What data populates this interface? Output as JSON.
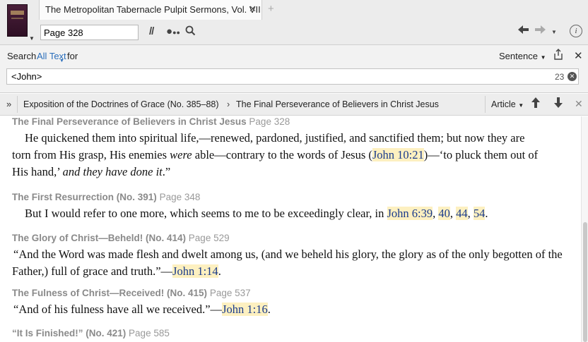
{
  "tab": {
    "title": "The Metropolitan Tabernacle Pulpit Sermons, Vol. VII",
    "close_glyph": "✕",
    "add_glyph": "+"
  },
  "toolbar": {
    "page_value": "Page 328",
    "icons": [
      "book-cover-icon",
      "parallel-resources-icon",
      "visual-filter-icon",
      "search-icon",
      "back-arrow-icon",
      "forward-arrow-icon",
      "info-icon"
    ]
  },
  "search": {
    "label": "Search",
    "scope": "All Text",
    "for_label": "for",
    "mode": "Sentence",
    "query": "<John>",
    "result_count": "23"
  },
  "breadcrumb": {
    "items": [
      "Exposition of the Doctrines of Grace (No. 385–88)",
      "The Final Perseverance of Believers in Christ Jesus"
    ],
    "separator": "›",
    "view_mode": "Article"
  },
  "results": [
    {
      "title": "The Final Perseverance of Believers in Christ Jesus",
      "page": "Page 328",
      "lines": [
        [
          {
            "t": "He quickened them into spiritual life,—renewed, pardoned, justified, and sanctified them; but now they are"
          }
        ],
        [
          {
            "t": "torn from His grasp, His enemies "
          },
          {
            "t": "were",
            "i": true
          },
          {
            "t": " able—contrary to the words of Jesus ("
          },
          {
            "t": "John 10:21",
            "h": true
          },
          {
            "t": ")—‘to pluck them out of"
          }
        ],
        [
          {
            "t": "His hand,’ "
          },
          {
            "t": "and they have done it",
            "i": true
          },
          {
            "t": ".”"
          }
        ]
      ]
    },
    {
      "title": "The First Resurrection (No. 391)",
      "page": "Page 348",
      "lines": [
        [
          {
            "t": "But I would refer to one more, which seems to me to be exceedingly clear, in "
          },
          {
            "t": "John 6:39",
            "h": true
          },
          {
            "t": ", "
          },
          {
            "t": "40",
            "h": true
          },
          {
            "t": ", "
          },
          {
            "t": "44",
            "h": true
          },
          {
            "t": ", "
          },
          {
            "t": "54",
            "h": true
          },
          {
            "t": "."
          }
        ]
      ]
    },
    {
      "title": "The Glory of Christ—Beheld! (No. 414)",
      "page": "Page 529",
      "lines": [
        [
          {
            "t": "“And the Word was made flesh and dwelt among us, (and we beheld his glory, the glory as of the only begotten of the"
          }
        ],
        [
          {
            "t": "Father,) full of grace and truth.”—"
          },
          {
            "t": "John 1:14",
            "h": true
          },
          {
            "t": "."
          }
        ]
      ]
    },
    {
      "title": "The Fulness of Christ—Received! (No. 415)",
      "page": "Page 537",
      "lines": [
        [
          {
            "t": "“And of his fulness have all we received.”—"
          },
          {
            "t": "John 1:16",
            "h": true
          },
          {
            "t": "."
          }
        ]
      ]
    },
    {
      "title": "“It Is Finished!” (No. 421)",
      "page": "Page 585",
      "lines": []
    }
  ]
}
